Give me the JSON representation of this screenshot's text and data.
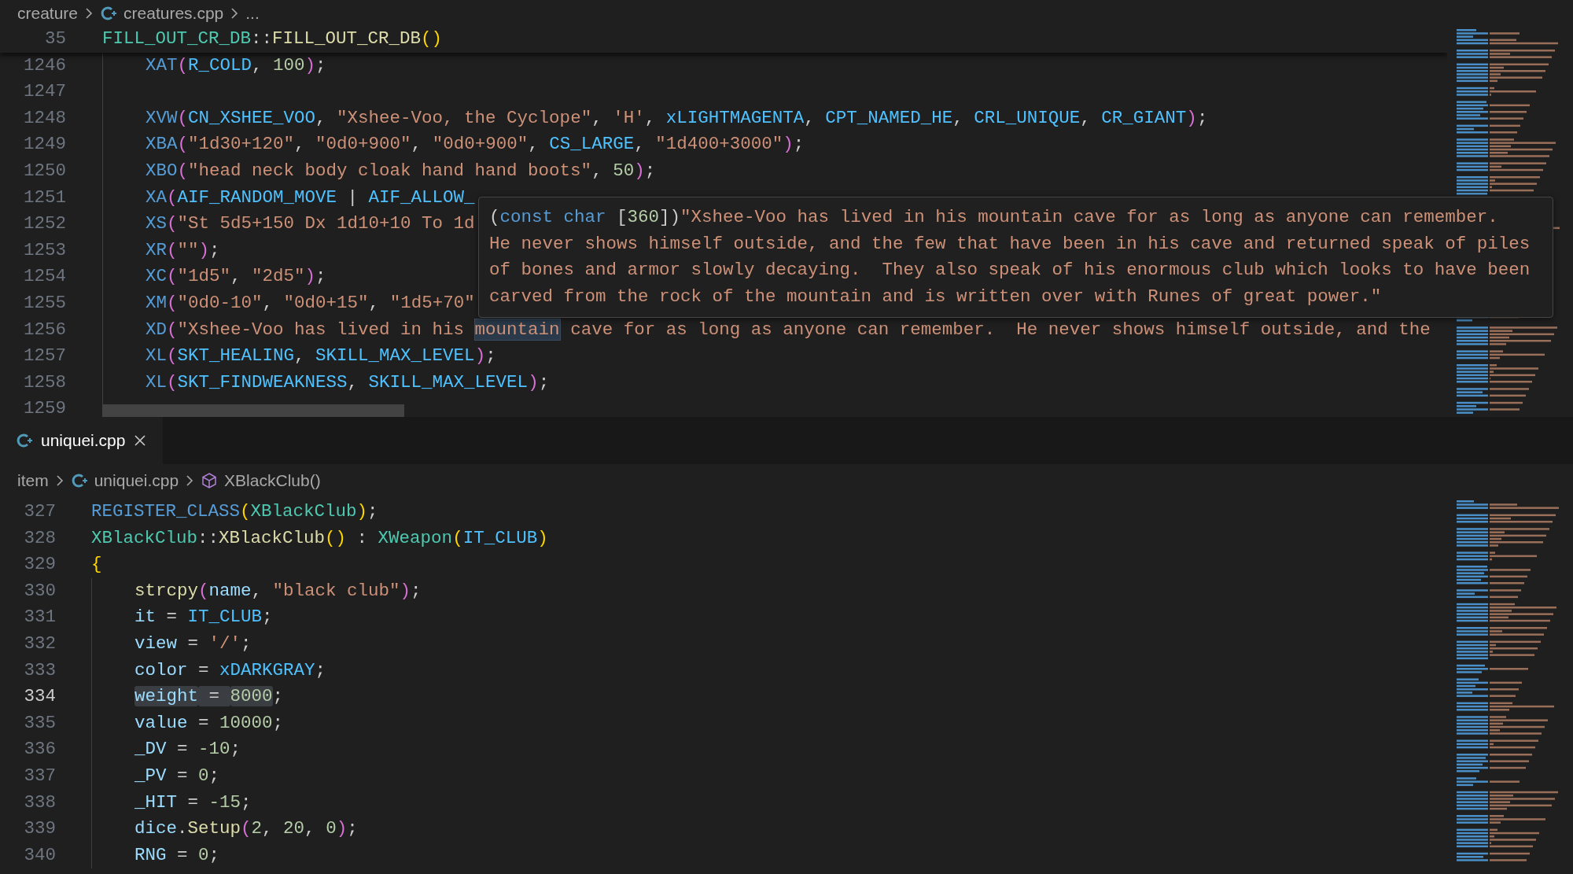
{
  "top_editor": {
    "breadcrumbs": [
      {
        "kind": "folder",
        "text": "creature"
      },
      {
        "kind": "file",
        "text": "creatures.cpp"
      },
      {
        "kind": "more",
        "text": "..."
      }
    ],
    "sticky_line": {
      "number": "35",
      "current": false,
      "tokens": [
        {
          "kind": "type",
          "text": "FILL_OUT_CR_DB"
        },
        {
          "kind": "plain",
          "text": "::"
        },
        {
          "kind": "function",
          "text": "FILL_OUT_CR_DB"
        },
        {
          "kind": "bracket1",
          "text": "()"
        }
      ],
      "children": [
        {
          "number": "1246",
          "current": false,
          "tokens": [
            {
              "kind": "macro",
              "text": "XAT"
            },
            {
              "kind": "bracket2",
              "text": "("
            },
            {
              "kind": "constant",
              "text": "R_COLD"
            },
            {
              "kind": "plain",
              "text": ", "
            },
            {
              "kind": "number",
              "text": "100"
            },
            {
              "kind": "bracket2",
              "text": ")"
            },
            {
              "kind": "plain",
              "text": ";"
            }
          ]
        },
        {
          "number": "1247",
          "current": false
        },
        {
          "number": "1248",
          "current": false,
          "tokens": [
            {
              "kind": "macro",
              "text": "XVW"
            },
            {
              "kind": "bracket2",
              "text": "("
            },
            {
              "kind": "constant",
              "text": "CN_XSHEE_VOO"
            },
            {
              "kind": "plain",
              "text": ", "
            },
            {
              "kind": "string",
              "text": "\"Xshee-Voo, the Cyclope\""
            },
            {
              "kind": "plain",
              "text": ", "
            },
            {
              "kind": "string",
              "text": "'H'"
            },
            {
              "kind": "plain",
              "text": ", "
            },
            {
              "kind": "constant",
              "text": "xLIGHTMAGENTA"
            },
            {
              "kind": "plain",
              "text": ", "
            },
            {
              "kind": "constant",
              "text": "CPT_NAMED_HE"
            },
            {
              "kind": "plain",
              "text": ", "
            },
            {
              "kind": "constant",
              "text": "CRL_UNIQUE"
            },
            {
              "kind": "plain",
              "text": ", "
            },
            {
              "kind": "constant",
              "text": "CR_GIANT"
            },
            {
              "kind": "bracket2",
              "text": ")"
            },
            {
              "kind": "plain",
              "text": ";"
            }
          ]
        },
        {
          "number": "1249",
          "current": false,
          "tokens": [
            {
              "kind": "macro",
              "text": "XBA"
            },
            {
              "kind": "bracket2",
              "text": "("
            },
            {
              "kind": "string",
              "text": "\"1d30+120\""
            },
            {
              "kind": "plain",
              "text": ", "
            },
            {
              "kind": "string",
              "text": "\"0d0+900\""
            },
            {
              "kind": "plain",
              "text": ", "
            },
            {
              "kind": "string",
              "text": "\"0d0+900\""
            },
            {
              "kind": "plain",
              "text": ", "
            },
            {
              "kind": "constant",
              "text": "CS_LARGE"
            },
            {
              "kind": "plain",
              "text": ", "
            },
            {
              "kind": "string",
              "text": "\"1d400+3000\""
            },
            {
              "kind": "bracket2",
              "text": ")"
            },
            {
              "kind": "plain",
              "text": ";"
            }
          ]
        },
        {
          "number": "1250",
          "current": false,
          "tokens": [
            {
              "kind": "macro",
              "text": "XBO"
            },
            {
              "kind": "bracket2",
              "text": "("
            },
            {
              "kind": "string",
              "text": "\"head neck body cloak hand hand boots\""
            },
            {
              "kind": "plain",
              "text": ", "
            },
            {
              "kind": "number",
              "text": "50"
            },
            {
              "kind": "bracket2",
              "text": ")"
            },
            {
              "kind": "plain",
              "text": ";"
            }
          ]
        },
        {
          "number": "1251",
          "current": false,
          "tokens": [
            {
              "kind": "macro",
              "text": "XA"
            },
            {
              "kind": "bracket2",
              "text": "("
            },
            {
              "kind": "constant",
              "text": "AIF_RANDOM_MOVE"
            },
            {
              "kind": "plain",
              "text": " | "
            },
            {
              "kind": "constant",
              "text": "AIF_ALLOW_"
            }
          ]
        },
        {
          "number": "1252",
          "current": false,
          "tokens": [
            {
              "kind": "macro",
              "text": "XS"
            },
            {
              "kind": "bracket2",
              "text": "("
            },
            {
              "kind": "string",
              "text": "\"St 5d5+150 Dx 1d10+10 To 1d"
            }
          ]
        },
        {
          "number": "1253",
          "current": false,
          "tokens": [
            {
              "kind": "macro",
              "text": "XR"
            },
            {
              "kind": "bracket2",
              "text": "("
            },
            {
              "kind": "string",
              "text": "\"\""
            },
            {
              "kind": "bracket2",
              "text": ")"
            },
            {
              "kind": "plain",
              "text": ";"
            }
          ]
        },
        {
          "number": "1254",
          "current": false,
          "tokens": [
            {
              "kind": "macro",
              "text": "XC"
            },
            {
              "kind": "bracket2",
              "text": "("
            },
            {
              "kind": "string",
              "text": "\"1d5\""
            },
            {
              "kind": "plain",
              "text": ", "
            },
            {
              "kind": "string",
              "text": "\"2d5\""
            },
            {
              "kind": "bracket2",
              "text": ")"
            },
            {
              "kind": "plain",
              "text": ";"
            }
          ]
        },
        {
          "number": "1255",
          "current": false,
          "tokens": [
            {
              "kind": "macro",
              "text": "XM"
            },
            {
              "kind": "bracket2",
              "text": "("
            },
            {
              "kind": "string",
              "text": "\"0d0-10\""
            },
            {
              "kind": "plain",
              "text": ", "
            },
            {
              "kind": "string",
              "text": "\"0d0+15\""
            },
            {
              "kind": "plain",
              "text": ", "
            },
            {
              "kind": "string",
              "text": "\"1d5+70\""
            }
          ]
        },
        {
          "number": "1256",
          "current": false,
          "tokens": [
            {
              "kind": "macro",
              "text": "XD"
            },
            {
              "kind": "bracket2",
              "text": "("
            },
            {
              "kind": "string",
              "text": "\"Xshee-Voo has lived in his "
            },
            {
              "kind": "string",
              "text": "mountain",
              "hovered": true
            },
            {
              "kind": "string",
              "text": " cave for as long as anyone can remember.  He never shows himself outside, and the"
            }
          ]
        },
        {
          "number": "1257",
          "current": false,
          "tokens": [
            {
              "kind": "macro",
              "text": "XL"
            },
            {
              "kind": "bracket2",
              "text": "("
            },
            {
              "kind": "constant",
              "text": "SKT_HEALING"
            },
            {
              "kind": "plain",
              "text": ", "
            },
            {
              "kind": "constant",
              "text": "SKILL_MAX_LEVEL"
            },
            {
              "kind": "bracket2",
              "text": ")"
            },
            {
              "kind": "plain",
              "text": ";"
            }
          ]
        },
        {
          "number": "1258",
          "current": false,
          "tokens": [
            {
              "kind": "macro",
              "text": "XL"
            },
            {
              "kind": "bracket2",
              "text": "("
            },
            {
              "kind": "constant",
              "text": "SKT_FINDWEAKNESS"
            },
            {
              "kind": "plain",
              "text": ", "
            },
            {
              "kind": "constant",
              "text": "SKILL_MAX_LEVEL"
            },
            {
              "kind": "bracket2",
              "text": ")"
            },
            {
              "kind": "plain",
              "text": ";"
            }
          ]
        },
        {
          "number": "1259",
          "current": false
        }
      ]
    },
    "hover_tooltip": {
      "lines": [
        {
          "tokens": [
            {
              "kind": "plain",
              "text": "("
            },
            {
              "kind": "keyword",
              "text": "const char"
            },
            {
              "kind": "plain",
              "text": " ["
            },
            {
              "kind": "number",
              "text": "360"
            },
            {
              "kind": "plain",
              "text": "])"
            },
            {
              "kind": "string",
              "text": "\"Xshee-Voo has lived in his mountain cave for as long as anyone can remember."
            }
          ]
        },
        {
          "tokens": [
            {
              "kind": "string",
              "text": "He never shows himself outside, and the few that have been in his cave and returned speak of piles"
            }
          ]
        },
        {
          "tokens": [
            {
              "kind": "string",
              "text": "of bones and armor slowly decaying.  They also speak of his enormous club which looks to have been"
            }
          ]
        },
        {
          "tokens": [
            {
              "kind": "string",
              "text": "carved from the rock of the mountain and is written over with Runes of great power.\""
            }
          ]
        }
      ]
    }
  },
  "bottom_editor": {
    "tabs": [
      {
        "label": "uniquei.cpp",
        "selected": true
      }
    ],
    "breadcrumbs": [
      {
        "kind": "folder",
        "text": "item"
      },
      {
        "kind": "file",
        "text": "uniquei.cpp"
      },
      {
        "kind": "symbol",
        "text": "XBlackClub()"
      }
    ],
    "lines": [
      {
        "number": "327",
        "current": false,
        "tokens": [
          {
            "kind": "macro",
            "text": "REGISTER_CLASS"
          },
          {
            "kind": "bracket1",
            "text": "("
          },
          {
            "kind": "type",
            "text": "XBlackClub"
          },
          {
            "kind": "bracket1",
            "text": ")"
          },
          {
            "kind": "plain",
            "text": ";"
          }
        ]
      },
      {
        "number": "328",
        "current": false,
        "tokens": [
          {
            "kind": "type",
            "text": "XBlackClub"
          },
          {
            "kind": "plain",
            "text": "::"
          },
          {
            "kind": "function",
            "text": "XBlackClub"
          },
          {
            "kind": "bracket1",
            "text": "()"
          },
          {
            "kind": "plain",
            "text": " : "
          },
          {
            "kind": "type",
            "text": "XWeapon"
          },
          {
            "kind": "bracket1",
            "text": "("
          },
          {
            "kind": "constant",
            "text": "IT_CLUB"
          },
          {
            "kind": "bracket1",
            "text": ")"
          }
        ]
      },
      {
        "number": "329",
        "current": false,
        "tokens": [
          {
            "kind": "bracket1",
            "text": "{"
          }
        ],
        "children": [
          {
            "number": "330",
            "current": false,
            "tokens": [
              {
                "kind": "function",
                "text": "strcpy"
              },
              {
                "kind": "bracket2",
                "text": "("
              },
              {
                "kind": "variable",
                "text": "name"
              },
              {
                "kind": "plain",
                "text": ", "
              },
              {
                "kind": "string",
                "text": "\"black club\""
              },
              {
                "kind": "bracket2",
                "text": ")"
              },
              {
                "kind": "plain",
                "text": ";"
              }
            ]
          },
          {
            "number": "331",
            "current": false,
            "tokens": [
              {
                "kind": "variable",
                "text": "it"
              },
              {
                "kind": "plain",
                "text": " = "
              },
              {
                "kind": "constant",
                "text": "IT_CLUB"
              },
              {
                "kind": "plain",
                "text": ";"
              }
            ]
          },
          {
            "number": "332",
            "current": false,
            "tokens": [
              {
                "kind": "variable",
                "text": "view"
              },
              {
                "kind": "plain",
                "text": " = "
              },
              {
                "kind": "string",
                "text": "'/'"
              },
              {
                "kind": "plain",
                "text": ";"
              }
            ]
          },
          {
            "number": "333",
            "current": false,
            "tokens": [
              {
                "kind": "variable",
                "text": "color"
              },
              {
                "kind": "plain",
                "text": " = "
              },
              {
                "kind": "constant",
                "text": "xDARKGRAY"
              },
              {
                "kind": "plain",
                "text": ";"
              }
            ]
          },
          {
            "number": "334",
            "current": true,
            "tokens": [
              {
                "kind": "variable",
                "text": "weight",
                "in_selection": true
              },
              {
                "kind": "plain",
                "text": " = ",
                "in_selection": true
              },
              {
                "kind": "number",
                "text": "8000",
                "in_selection": true
              },
              {
                "kind": "plain",
                "text": ";"
              }
            ]
          },
          {
            "number": "335",
            "current": false,
            "tokens": [
              {
                "kind": "variable",
                "text": "value"
              },
              {
                "kind": "plain",
                "text": " = "
              },
              {
                "kind": "number",
                "text": "10000"
              },
              {
                "kind": "plain",
                "text": ";"
              }
            ]
          },
          {
            "number": "336",
            "current": false,
            "tokens": [
              {
                "kind": "variable",
                "text": "_DV"
              },
              {
                "kind": "plain",
                "text": " = "
              },
              {
                "kind": "number",
                "text": "-10"
              },
              {
                "kind": "plain",
                "text": ";"
              }
            ]
          },
          {
            "number": "337",
            "current": false,
            "tokens": [
              {
                "kind": "variable",
                "text": "_PV"
              },
              {
                "kind": "plain",
                "text": " = "
              },
              {
                "kind": "number",
                "text": "0"
              },
              {
                "kind": "plain",
                "text": ";"
              }
            ]
          },
          {
            "number": "338",
            "current": false,
            "tokens": [
              {
                "kind": "variable",
                "text": "_HIT"
              },
              {
                "kind": "plain",
                "text": " = "
              },
              {
                "kind": "number",
                "text": "-15"
              },
              {
                "kind": "plain",
                "text": ";"
              }
            ]
          },
          {
            "number": "339",
            "current": false,
            "tokens": [
              {
                "kind": "variable",
                "text": "dice"
              },
              {
                "kind": "plain",
                "text": "."
              },
              {
                "kind": "function",
                "text": "Setup"
              },
              {
                "kind": "bracket2",
                "text": "("
              },
              {
                "kind": "number",
                "text": "2"
              },
              {
                "kind": "plain",
                "text": ", "
              },
              {
                "kind": "number",
                "text": "20"
              },
              {
                "kind": "plain",
                "text": ", "
              },
              {
                "kind": "number",
                "text": "0"
              },
              {
                "kind": "bracket2",
                "text": ")"
              },
              {
                "kind": "plain",
                "text": ";"
              }
            ]
          },
          {
            "number": "340",
            "current": false,
            "tokens": [
              {
                "kind": "variable",
                "text": "RNG"
              },
              {
                "kind": "plain",
                "text": " = "
              },
              {
                "kind": "number",
                "text": "0"
              },
              {
                "kind": "plain",
                "text": ";"
              }
            ]
          }
        ]
      }
    ]
  }
}
